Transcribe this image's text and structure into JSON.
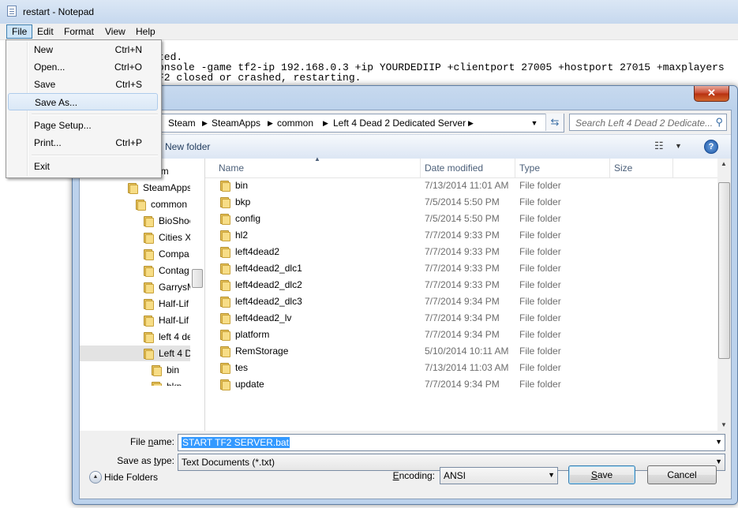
{
  "notepad": {
    "title": "restart - Notepad",
    "menu": [
      "File",
      "Edit",
      "Format",
      "View",
      "Help"
    ],
    "lines": [
      "ted.",
      "onsole -game tf2-ip 192.168.0.3 +ip YOURDEDIIP +clientport 27005 +hostport 27015 +maxplayers",
      "F2 closed or crashed, restarting."
    ]
  },
  "file_menu": {
    "items": [
      {
        "label": "New",
        "shortcut": "Ctrl+N"
      },
      {
        "label": "Open...",
        "shortcut": "Ctrl+O"
      },
      {
        "label": "Save",
        "shortcut": "Ctrl+S"
      },
      {
        "label": "Save As...",
        "shortcut": ""
      },
      {
        "label": "Page Setup...",
        "shortcut": ""
      },
      {
        "label": "Print...",
        "shortcut": "Ctrl+P"
      },
      {
        "label": "Exit",
        "shortcut": ""
      }
    ]
  },
  "dialog": {
    "close_glyph": "✕",
    "address": [
      "Steam",
      "SteamApps",
      "common",
      "Left 4 Dead 2 Dedicated Server"
    ],
    "search_placeholder": "Search Left 4 Dead 2 Dedicate...",
    "toolbar": {
      "new_folder": "New folder",
      "help": "?"
    },
    "nav_tree": [
      "steam",
      "SteamApps",
      "common",
      "BioShoc",
      "Cities X",
      "Compa",
      "Contag",
      "GarrysM",
      "Half-Lif",
      "Half-Lif",
      "left 4 de",
      "Left 4 D",
      "bin",
      "bkp"
    ],
    "columns": {
      "name": "Name",
      "date": "Date modified",
      "type": "Type",
      "size": "Size"
    },
    "files": [
      {
        "name": "bin",
        "date": "7/13/2014 11:01 AM",
        "type": "File folder"
      },
      {
        "name": "bkp",
        "date": "7/5/2014 5:50 PM",
        "type": "File folder"
      },
      {
        "name": "config",
        "date": "7/5/2014 5:50 PM",
        "type": "File folder"
      },
      {
        "name": "hl2",
        "date": "7/7/2014 9:33 PM",
        "type": "File folder"
      },
      {
        "name": "left4dead2",
        "date": "7/7/2014 9:33 PM",
        "type": "File folder"
      },
      {
        "name": "left4dead2_dlc1",
        "date": "7/7/2014 9:33 PM",
        "type": "File folder"
      },
      {
        "name": "left4dead2_dlc2",
        "date": "7/7/2014 9:33 PM",
        "type": "File folder"
      },
      {
        "name": "left4dead2_dlc3",
        "date": "7/7/2014 9:34 PM",
        "type": "File folder"
      },
      {
        "name": "left4dead2_lv",
        "date": "7/7/2014 9:34 PM",
        "type": "File folder"
      },
      {
        "name": "platform",
        "date": "7/7/2014 9:34 PM",
        "type": "File folder"
      },
      {
        "name": "RemStorage",
        "date": "5/10/2014 10:11 AM",
        "type": "File folder"
      },
      {
        "name": "tes",
        "date": "7/13/2014 11:03 AM",
        "type": "File folder"
      },
      {
        "name": "update",
        "date": "7/7/2014 9:34 PM",
        "type": "File folder"
      }
    ],
    "file_name_label_pre": "File ",
    "file_name_label_u": "n",
    "file_name_label_post": "ame:",
    "file_name_value": "START TF2 SERVER.bat",
    "save_type_label_pre": "Save as ",
    "save_type_label_u": "t",
    "save_type_label_post": "ype:",
    "save_type_value": "Text Documents (*.txt)",
    "hide_folders": "Hide Folders",
    "encoding_label_pre": "",
    "encoding_label_u": "E",
    "encoding_label_post": "ncoding:",
    "encoding_value": "ANSI",
    "save_pre": "",
    "save_u": "S",
    "save_post": "ave",
    "cancel": "Cancel"
  }
}
